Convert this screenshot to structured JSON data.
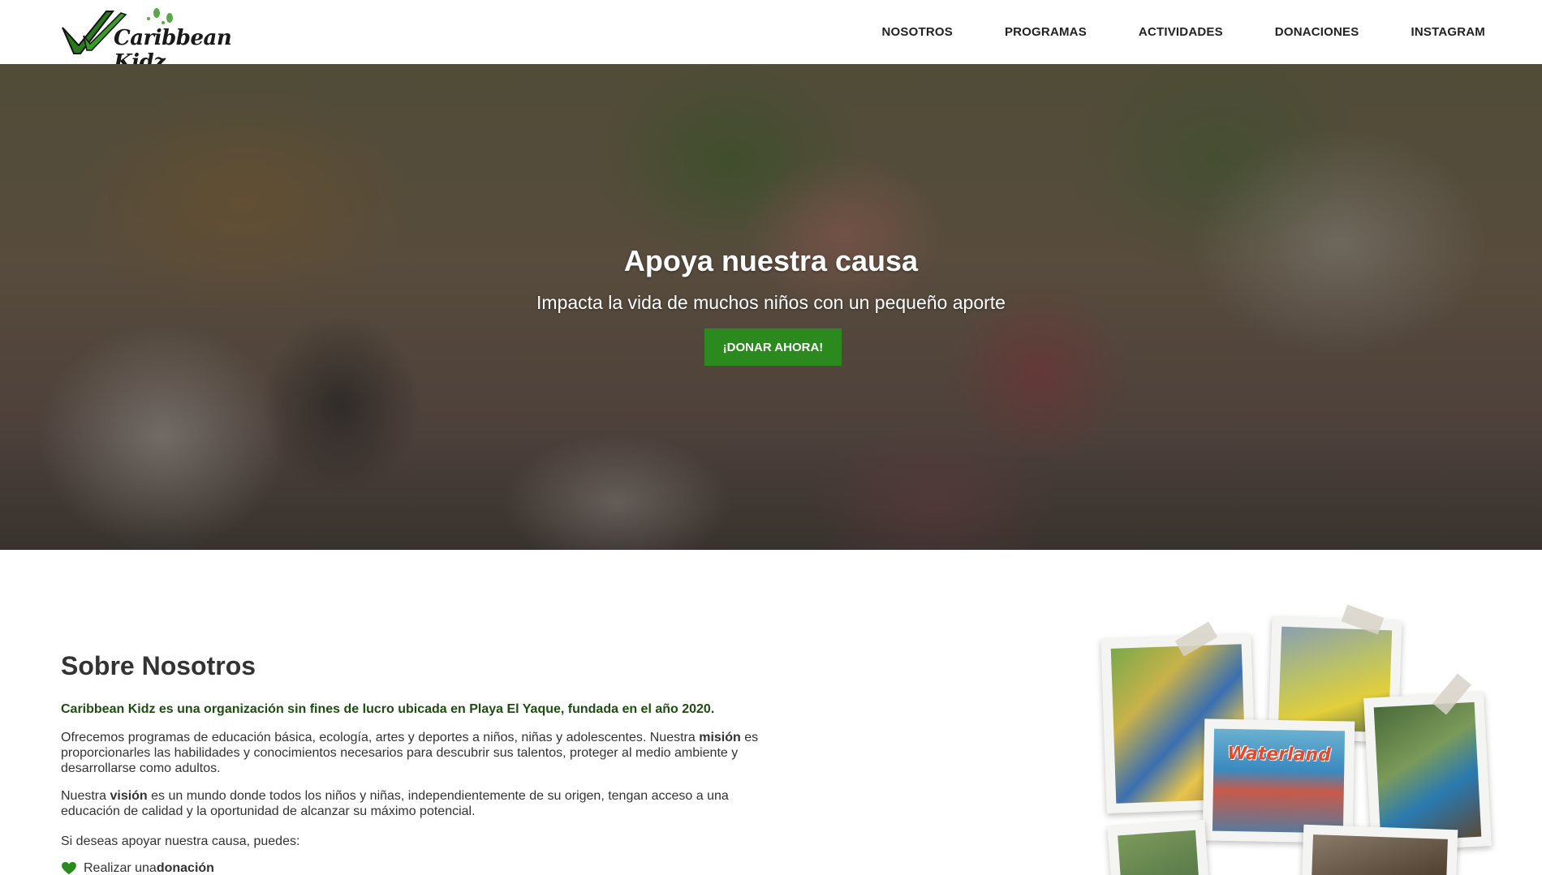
{
  "header": {
    "logo_text": "Caribbean Kidz",
    "nav": [
      "NOSOTROS",
      "PROGRAMAS",
      "ACTIVIDADES",
      "DONACIONES",
      "INSTAGRAM"
    ]
  },
  "hero": {
    "title": "Apoya nuestra causa",
    "subtitle": "Impacta la vida de muchos niños con un pequeño aporte",
    "cta_label": "¡DONAR AHORA!"
  },
  "about": {
    "title": "Sobre Nosotros",
    "lead": "Caribbean Kidz es una organización sin fines de lucro ubicada en Playa El Yaque, fundada en el año 2020.",
    "p1_pre": "Ofrecemos programas de educación básica, ecología, artes y deportes a niños, niñas y adolescentes. Nuestra ",
    "p1_bold": "misión",
    "p1_post": " es proporcionarles las habilidades y conocimientos necesarios para descubrir sus talentos, proteger al medio ambiente y desarrollarse como adultos.",
    "p2_pre": "Nuestra ",
    "p2_bold": "visión",
    "p2_post": " es un mundo donde todos los niños y niñas, independientemente de su origen, tengan acceso a una educación de calidad y la oportunidad de alcanzar su máximo potencial.",
    "p3": "Si deseas apoyar nuestra causa, puedes:",
    "bullet_pre": "Realizar una ",
    "bullet_bold": "donación"
  },
  "collage": {
    "sign_text": "Waterland"
  },
  "colors": {
    "accent_green": "#2a8a1e",
    "lead_green": "#1e4d12",
    "nav_text": "#222222"
  },
  "icons": [
    "logo-check-icon",
    "footprints-icon",
    "heart-icon"
  ]
}
